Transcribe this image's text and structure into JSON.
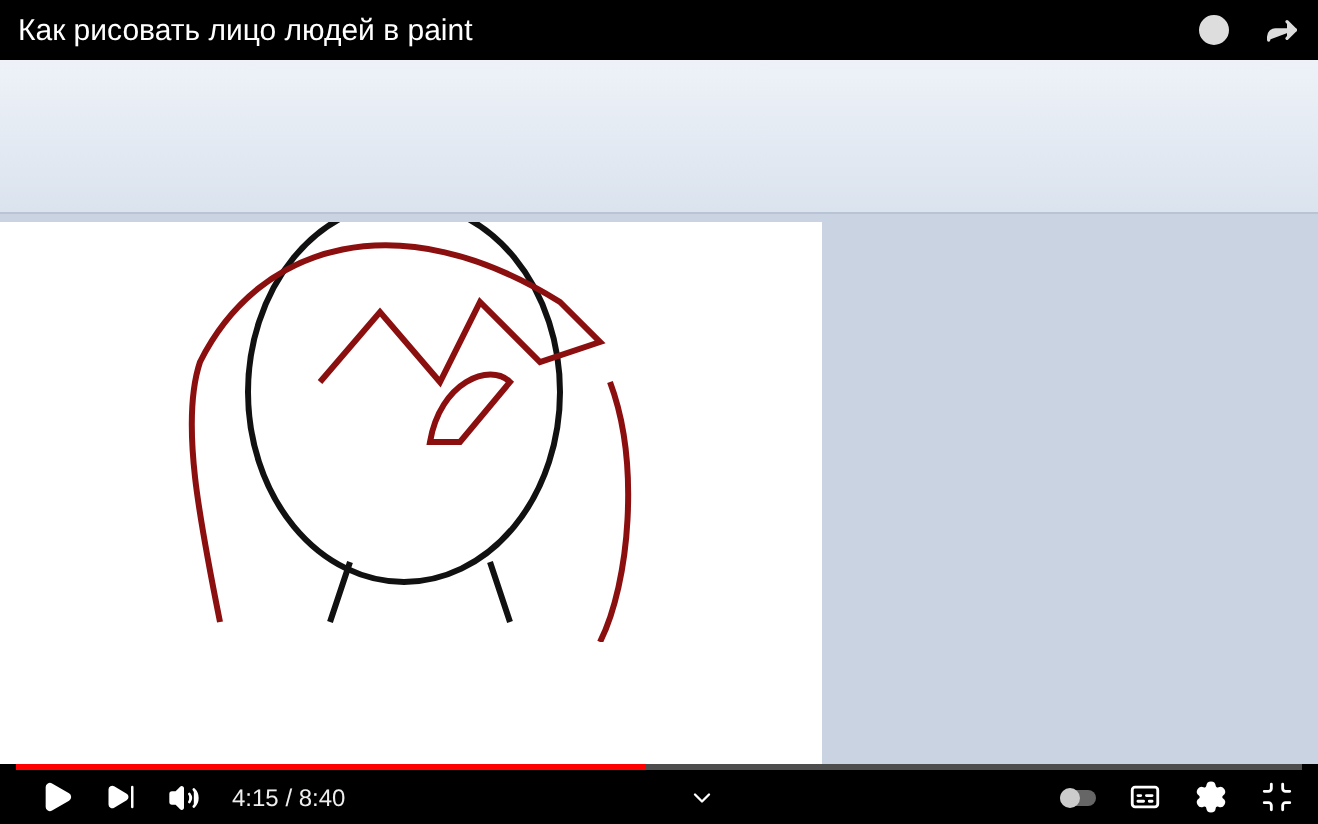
{
  "video": {
    "title": "Как рисовать лицо людей в paint"
  },
  "player": {
    "time": "4:15 / 8:40",
    "progress": {
      "level": 0.49
    },
    "autoplay": {
      "on": false
    }
  }
}
